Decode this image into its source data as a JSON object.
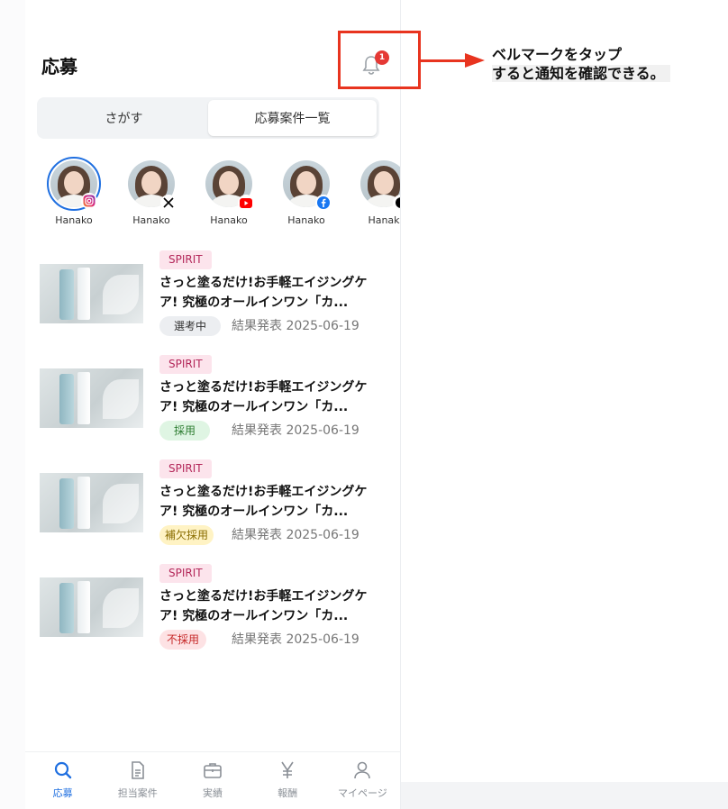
{
  "header": {
    "title": "応募"
  },
  "notification": {
    "badge_count": "1"
  },
  "annotation": {
    "line1": "ベルマークをタップ",
    "line2": "すると通知を確認できる。"
  },
  "tabs": [
    {
      "label": "さがす",
      "active": false
    },
    {
      "label": "応募案件一覧",
      "active": true
    }
  ],
  "accounts": [
    {
      "name": "Hanako",
      "sns": "instagram-icon",
      "sns_color": "#e1306c",
      "selected": true
    },
    {
      "name": "Hanako",
      "sns": "x-icon",
      "sns_color": "#000000",
      "selected": false
    },
    {
      "name": "Hanako",
      "sns": "youtube-icon",
      "sns_color": "#ff0000",
      "selected": false
    },
    {
      "name": "Hanako",
      "sns": "facebook-icon",
      "sns_color": "#1877f2",
      "selected": false
    },
    {
      "name": "Hanak",
      "sns": "tiktok-icon",
      "sns_color": "#000000",
      "selected": false
    }
  ],
  "applications": [
    {
      "brand": "SPIRIT",
      "title": "さっと塗るだけ!お手軽エイジングケア! 究極のオールインワン「カ...",
      "status": "選考中",
      "result": "結果発表 2025-06-19"
    },
    {
      "brand": "SPIRIT",
      "title": "さっと塗るだけ!お手軽エイジングケア! 究極のオールインワン「カ...",
      "status": "採用",
      "result": "結果発表 2025-06-19"
    },
    {
      "brand": "SPIRIT",
      "title": "さっと塗るだけ!お手軽エイジングケア! 究極のオールインワン「カ...",
      "status": "補欠採用",
      "result": "結果発表 2025-06-19"
    },
    {
      "brand": "SPIRIT",
      "title": "さっと塗るだけ!お手軽エイジングケア! 究極のオールインワン「カ...",
      "status": "不採用",
      "result": "結果発表 2025-06-19"
    }
  ],
  "bottom_nav": [
    {
      "label": "応募",
      "icon": "search-icon",
      "active": true
    },
    {
      "label": "担当案件",
      "icon": "document-icon",
      "active": false
    },
    {
      "label": "実績",
      "icon": "briefcase-icon",
      "active": false
    },
    {
      "label": "報酬",
      "icon": "yen-icon",
      "active": false
    },
    {
      "label": "マイページ",
      "icon": "person-icon",
      "active": false
    }
  ],
  "colors": {
    "accent": "#1f6fe0",
    "highlight": "#e8341f",
    "badge": "#e53935"
  }
}
